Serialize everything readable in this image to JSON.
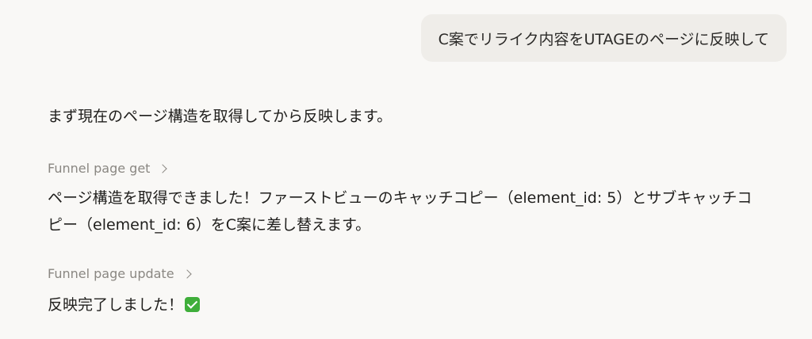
{
  "user_message": {
    "text": "C案でリライク内容をUTAGEのページに反映して"
  },
  "assistant": {
    "intro": "まず現在のページ構造を取得してから反映します。",
    "tool_calls": [
      {
        "label": "Funnel page get"
      },
      {
        "label": "Funnel page update"
      }
    ],
    "reply_after_get": "ページ構造を取得できました！ファーストビューのキャッチコピー（element_id: 5）とサブキャッチコピー（element_id: 6）をC案に差し替えます。",
    "reply_after_update": "反映完了しました！",
    "status_icon": "check-mark-emoji",
    "status_icon_color": "#3fae3a"
  }
}
